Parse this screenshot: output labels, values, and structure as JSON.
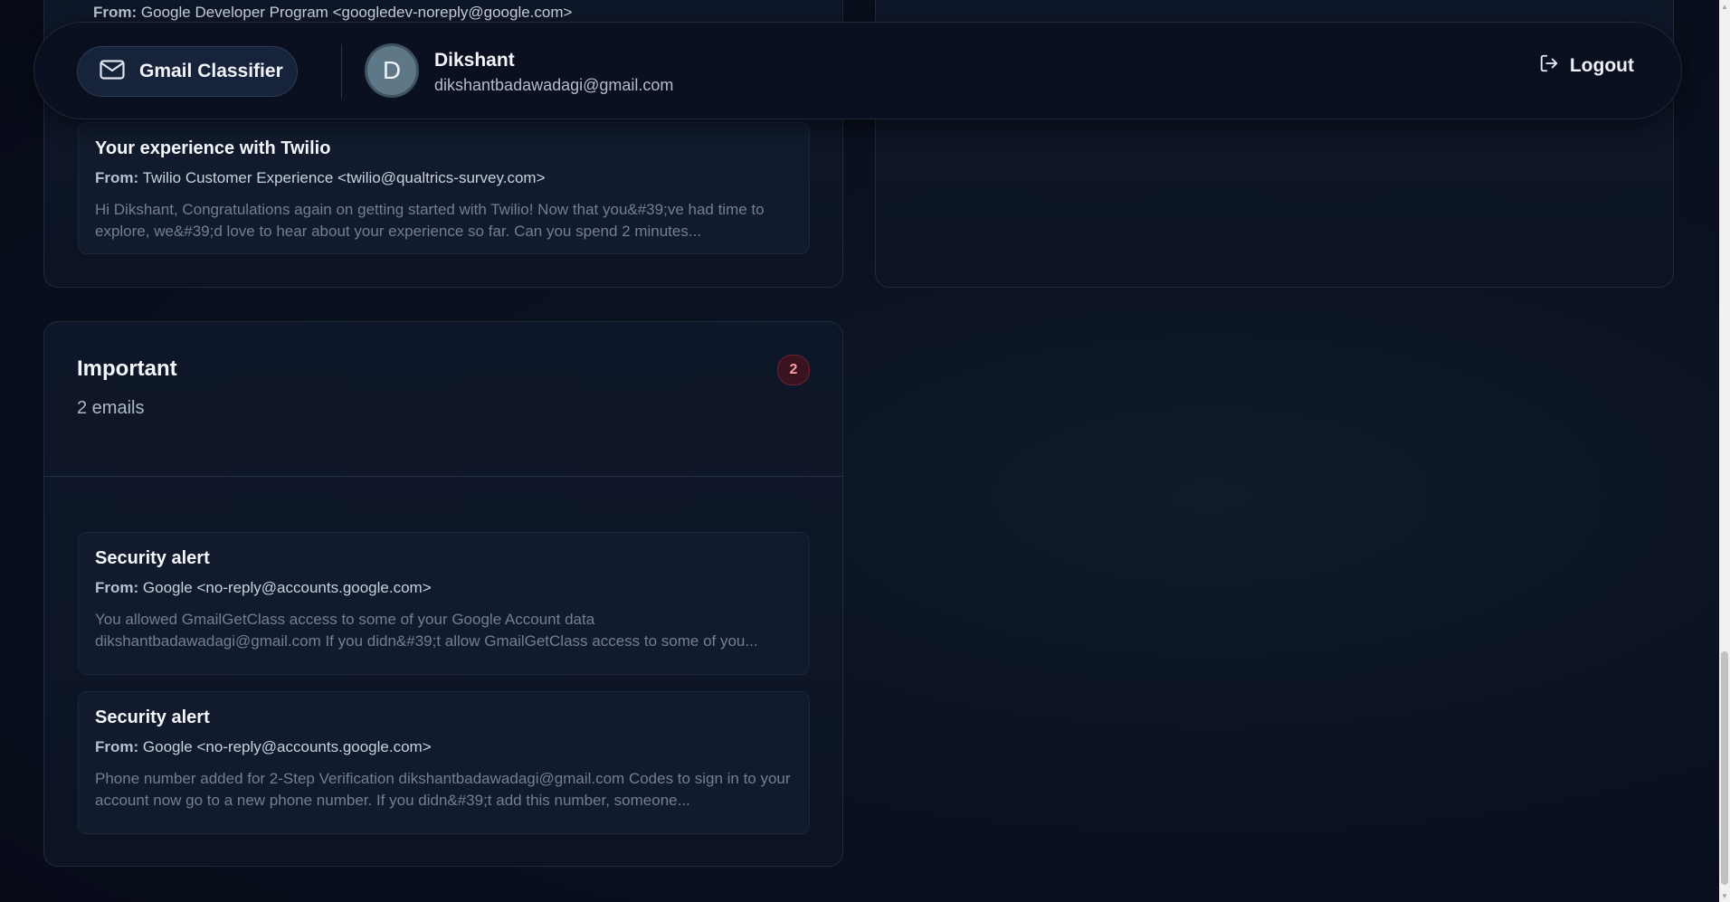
{
  "header": {
    "brand_label": "Gmail Classifier",
    "avatar_initial": "D",
    "user_name": "Dikshant",
    "user_email": "dikshantbadawadagi@gmail.com",
    "logout_label": "Logout"
  },
  "top_section": {
    "partial_from_label": "From:",
    "partial_from_value": "Google Developer Program <googledev-noreply@google.com>",
    "email": {
      "subject": "Your experience with Twilio",
      "from_label": "From:",
      "from_value": "Twilio Customer Experience <twilio@qualtrics-survey.com>",
      "snippet": "Hi Dikshant, Congratulations again on getting started with Twilio! Now that you&#39;ve had time to explore, we&#39;d love to hear about your experience so far. Can you spend 2 minutes..."
    }
  },
  "important": {
    "title": "Important",
    "count_text": "2 emails",
    "badge": "2",
    "emails": [
      {
        "subject": "Security alert",
        "from_label": "From:",
        "from_value": "Google <no-reply@accounts.google.com>",
        "snippet": "You allowed GmailGetClass access to some of your Google Account data dikshantbadawadagi@gmail.com If you didn&#39;t allow GmailGetClass access to some of you..."
      },
      {
        "subject": "Security alert",
        "from_label": "From:",
        "from_value": "Google <no-reply@accounts.google.com>",
        "snippet": "Phone number added for 2-Step Verification dikshantbadawadagi@gmail.com Codes to sign in to your account now go to a new phone number. If you didn&#39;t add this number, someone..."
      }
    ]
  },
  "colors": {
    "background": "#0a1020",
    "card": "#0e1729",
    "badge_text": "#ff9aab"
  }
}
